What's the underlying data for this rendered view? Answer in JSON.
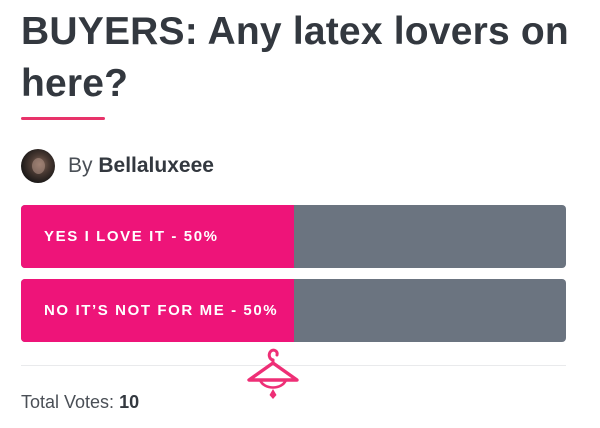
{
  "post": {
    "title": "BUYERS: Any latex lovers on here?",
    "author_prefix": "By",
    "author_name": "Bellaluxeee"
  },
  "poll": {
    "options": [
      {
        "label": "YES I LOVE IT - 50%",
        "percent": 50
      },
      {
        "label": "NO IT’S NOT FOR ME - 50%",
        "percent": 50
      }
    ],
    "fill_color": "#ee1479",
    "track_color": "#6b7480",
    "total_votes_label": "Total Votes:",
    "total_votes_count": "10"
  },
  "icons": {
    "avatar": "user-avatar",
    "watermark": "hanger-icon"
  },
  "colors": {
    "accent": "#e8336a",
    "heading": "#33383f"
  }
}
